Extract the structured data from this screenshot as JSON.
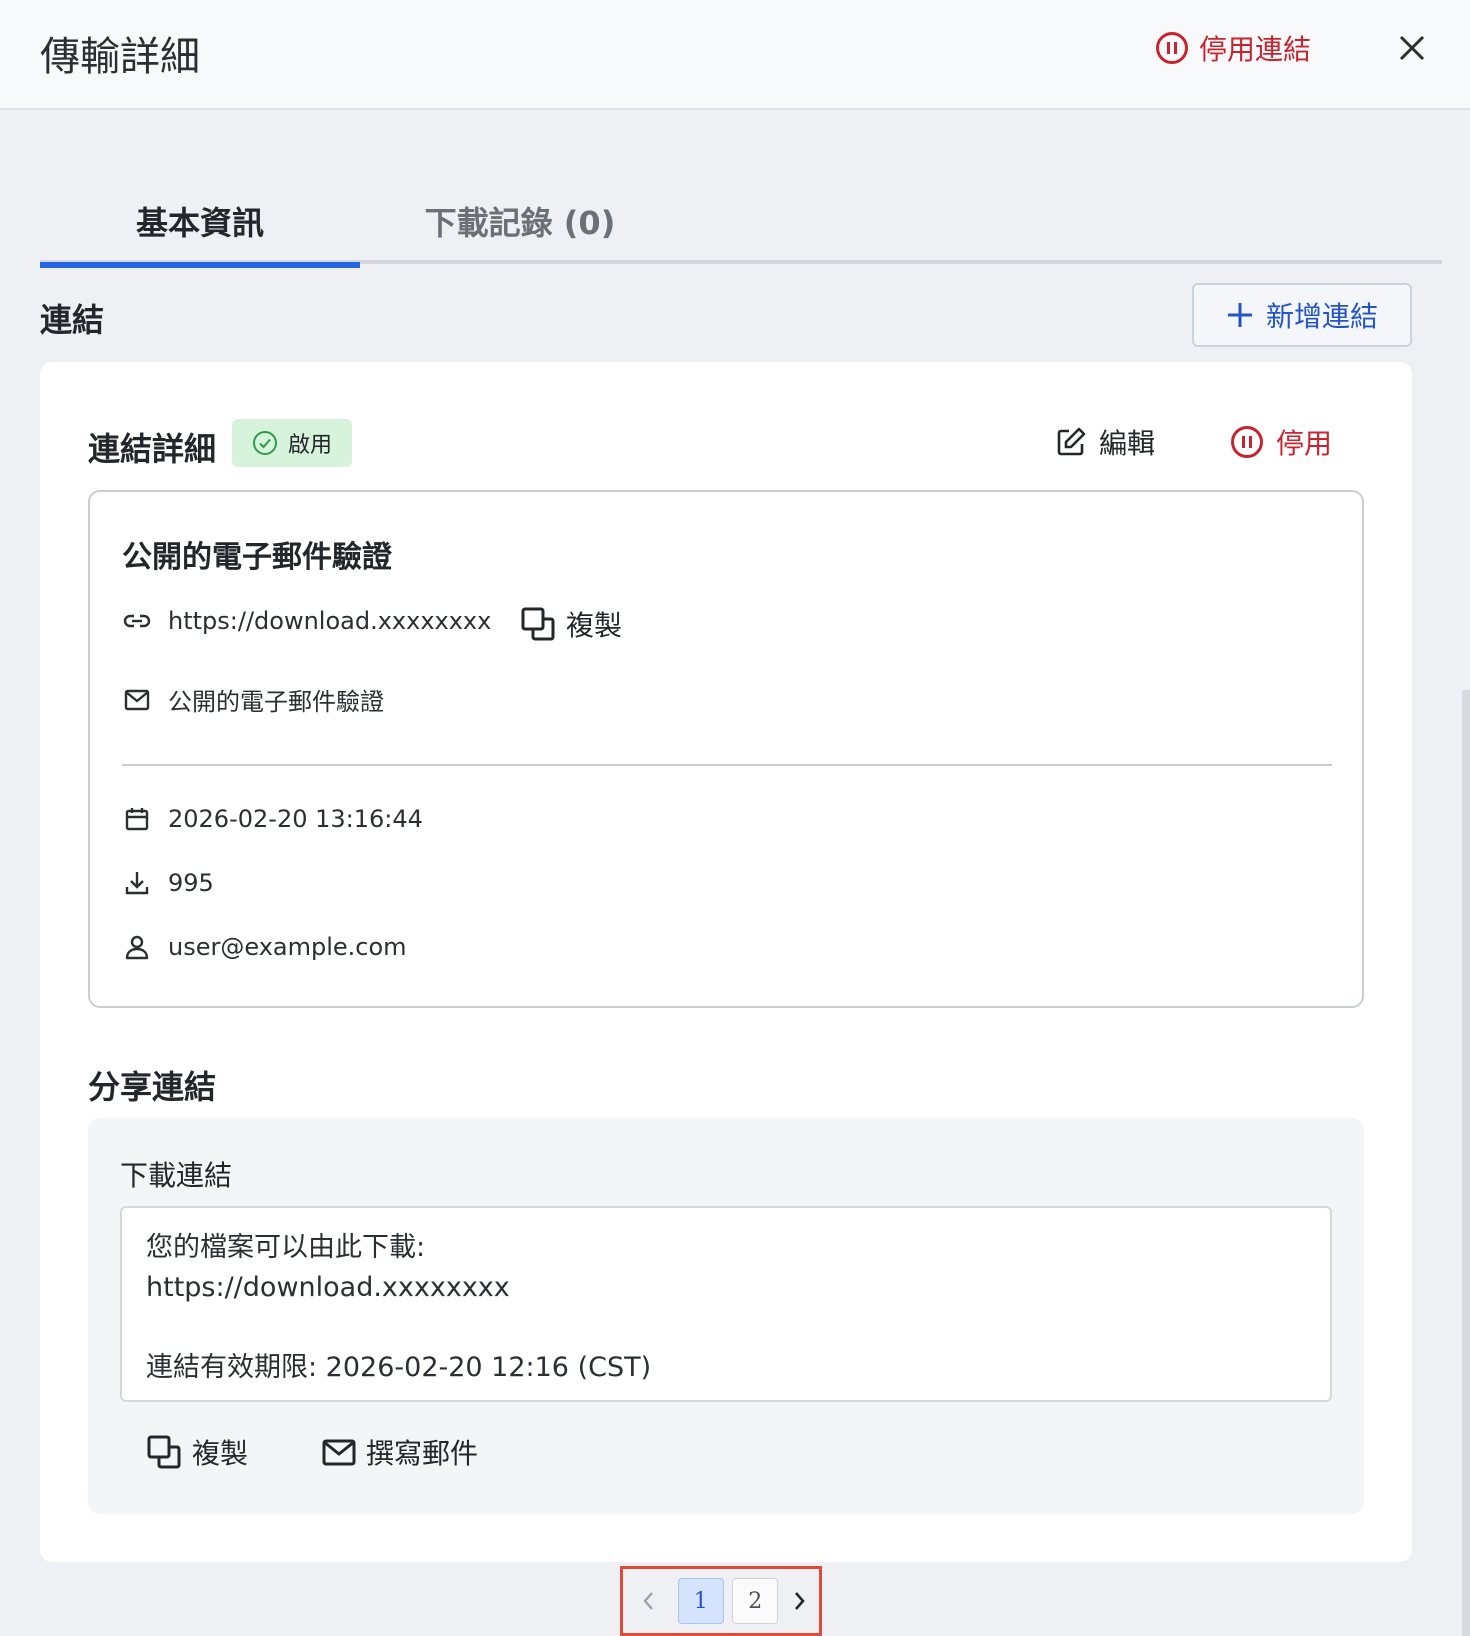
{
  "header": {
    "title": "傳輸詳細",
    "disable_link_label": "停用連結",
    "close_icon": "close-icon"
  },
  "tabs": [
    {
      "label": "基本資訊",
      "active": true
    },
    {
      "label": "下載記錄 (0)",
      "active": false
    }
  ],
  "links_section": {
    "title": "連結",
    "add_link_label": "新增連結"
  },
  "link_detail": {
    "title": "連結詳細",
    "status": "啟用",
    "edit_label": "編輯",
    "disable_label": "停用",
    "name": "公開的電子郵件驗證",
    "url": "https://download.xxxxxxxx",
    "copy_label": "複製",
    "verification": "公開的電子郵件驗證",
    "created_at": "2026-02-20 13:16:44",
    "download_count": "995",
    "creator": "user@example.com"
  },
  "share": {
    "title": "分享連結",
    "label": "下載連結",
    "text_line1": "您的檔案可以由此下載:",
    "text_line2": "https://download.xxxxxxxx",
    "text_line3": "連結有效期限: 2026-02-20 12:16 (CST)",
    "copy_label": "複製",
    "compose_label": "撰寫郵件"
  },
  "pagination": {
    "pages": [
      "1",
      "2"
    ],
    "current": "1"
  },
  "colors": {
    "accent_blue": "#2563e0",
    "danger_red": "#c8232f",
    "success_bg": "#d7f3dc",
    "success_icon": "#2e9b4a",
    "highlight_border": "#e04a38"
  }
}
